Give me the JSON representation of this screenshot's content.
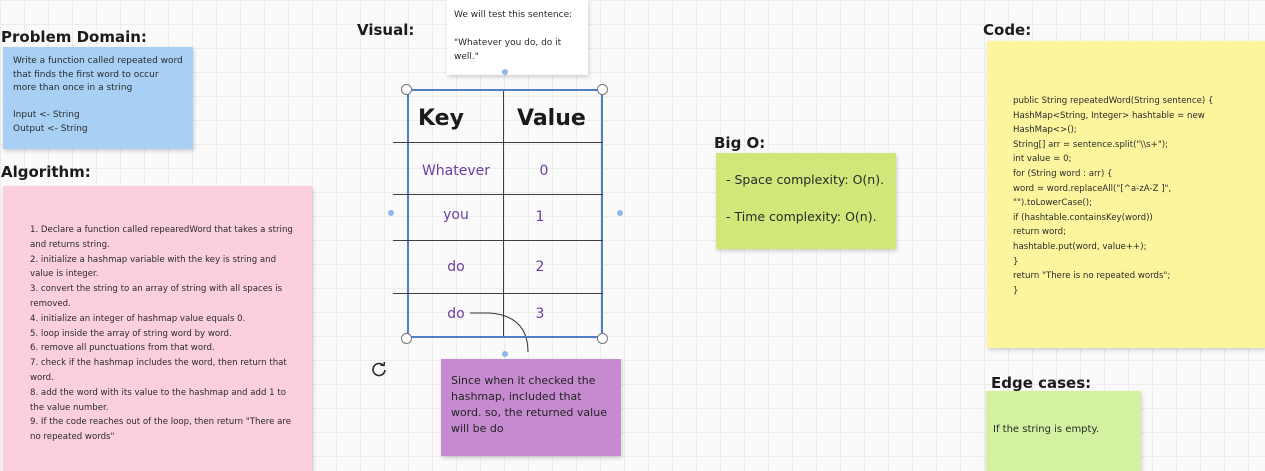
{
  "headings": {
    "problem_domain": "Problem Domain:",
    "algorithm": "Algorithm:",
    "visual": "Visual:",
    "big_o": "Big O:",
    "code": "Code:",
    "edge_cases": "Edge cases:"
  },
  "problem_note": "Write a function called repeated word that finds the first word to occur more than once in a string\n\nInput <- String\nOutput <- String",
  "algorithm_note": "1. Declare a function called repearedWord that takes a string and returns string.\n2. initialize a hashmap variable with the key is string and value is integer.\n3. convert the string to an array of string with all spaces is removed.\n4. initialize an integer of hashmap value equals 0.\n5. loop inside the array of string word by word.\n6. remove all punctuations from that word.\n7. check if the hashmap includes the word, then return that word.\n8. add the word with its value to the hashmap and add 1 to the value number.\n9. If the code reaches out of the loop, then return \"There are no repeated words\"",
  "test_note": "We will test this sentence:\n\n\"Whatever you do, do it well.\"",
  "table": {
    "key_header": "Key",
    "value_header": "Value",
    "rows": [
      {
        "key": "Whatever",
        "value": "0"
      },
      {
        "key": "you",
        "value": "1"
      },
      {
        "key": "do",
        "value": "2"
      },
      {
        "key": "do",
        "value": "3"
      }
    ]
  },
  "result_note": "Since when it checked the hashmap, included that word. so, the returned value will be do",
  "bigo_note": "- Space complexity: O(n).\n- Time complexity: O(n).",
  "code_note": "public String repeatedWord(String sentence) {\nHashMap<String, Integer> hashtable = new HashMap<>();\nString[] arr = sentence.split(\"\\\\s+\");\nint value = 0;\nfor (String word : arr) {\nword = word.replaceAll(\"[^a-zA-Z ]\", \"\").toLowerCase();\nif (hashtable.containsKey(word))\nreturn word;\nhashtable.put(word, value++);\n}\nreturn \"There is no repeated words\";\n}",
  "edge_note": "If the string is empty.",
  "colors": {
    "blue_note": "#a8d0f5",
    "pink_note": "#fccfe0",
    "green_note": "#cfe879",
    "yellow_note": "#fdf59e",
    "lightgreen_note": "#d3f1a0",
    "purple_note": "#c58ad0",
    "selection": "#4f80c7"
  },
  "icons": [
    "rotate-icon"
  ]
}
